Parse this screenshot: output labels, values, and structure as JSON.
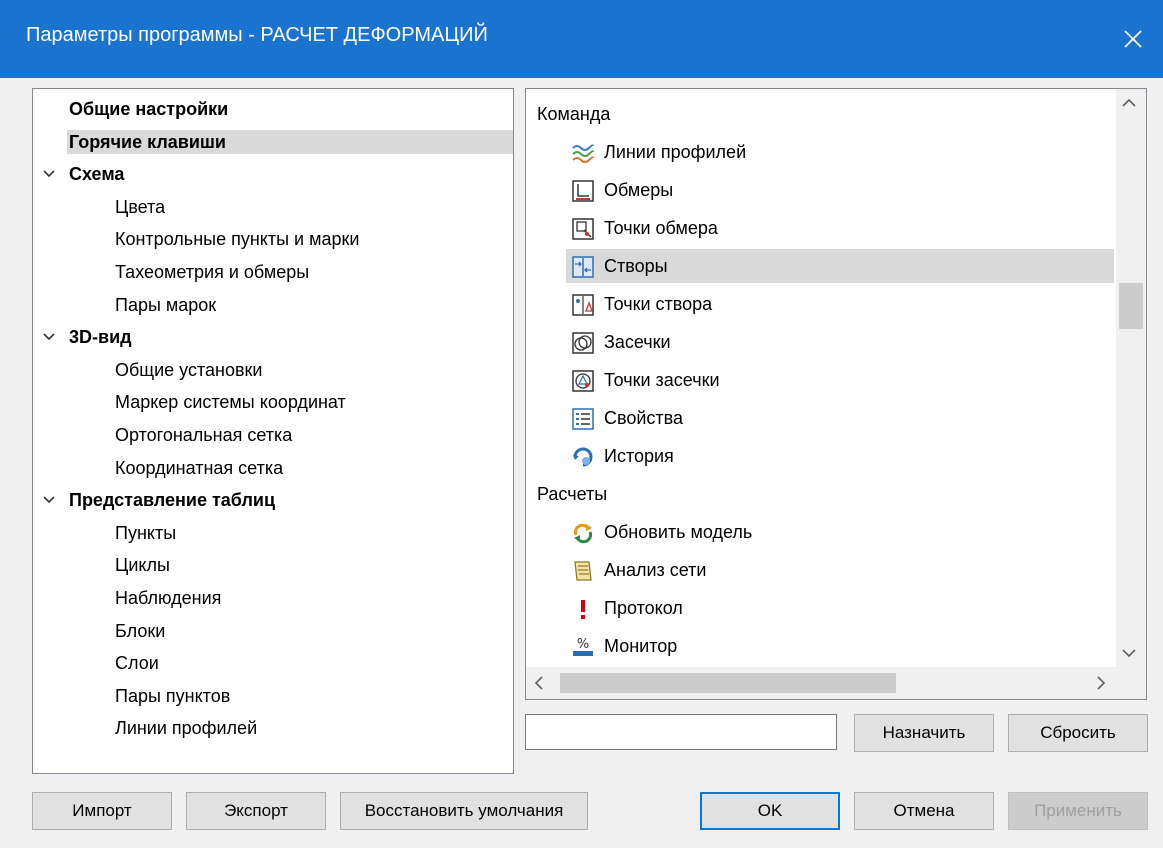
{
  "window": {
    "title": "Параметры программы - РАСЧЕТ ДЕФОРМАЦИЙ",
    "close_glyph": "✕"
  },
  "tree": {
    "items": [
      {
        "label": "Общие настройки",
        "level": 0,
        "bold": true,
        "expandable": false,
        "selected": false
      },
      {
        "label": "Горячие клавиши",
        "level": 0,
        "bold": true,
        "expandable": false,
        "selected": true
      },
      {
        "label": "Схема",
        "level": 0,
        "bold": true,
        "expandable": true,
        "selected": false
      },
      {
        "label": "Цвета",
        "level": 1,
        "bold": false,
        "expandable": false,
        "selected": false
      },
      {
        "label": "Контрольные пункты и марки",
        "level": 1,
        "bold": false,
        "expandable": false,
        "selected": false
      },
      {
        "label": "Тахеометрия и обмеры",
        "level": 1,
        "bold": false,
        "expandable": false,
        "selected": false
      },
      {
        "label": "Пары марок",
        "level": 1,
        "bold": false,
        "expandable": false,
        "selected": false
      },
      {
        "label": "3D-вид",
        "level": 0,
        "bold": true,
        "expandable": true,
        "selected": false
      },
      {
        "label": "Общие установки",
        "level": 1,
        "bold": false,
        "expandable": false,
        "selected": false
      },
      {
        "label": "Маркер системы координат",
        "level": 1,
        "bold": false,
        "expandable": false,
        "selected": false
      },
      {
        "label": "Ортогональная сетка",
        "level": 1,
        "bold": false,
        "expandable": false,
        "selected": false
      },
      {
        "label": "Координатная сетка",
        "level": 1,
        "bold": false,
        "expandable": false,
        "selected": false
      },
      {
        "label": "Представление таблиц",
        "level": 0,
        "bold": true,
        "expandable": true,
        "selected": false
      },
      {
        "label": "Пункты",
        "level": 1,
        "bold": false,
        "expandable": false,
        "selected": false
      },
      {
        "label": "Циклы",
        "level": 1,
        "bold": false,
        "expandable": false,
        "selected": false
      },
      {
        "label": "Наблюдения",
        "level": 1,
        "bold": false,
        "expandable": false,
        "selected": false
      },
      {
        "label": "Блоки",
        "level": 1,
        "bold": false,
        "expandable": false,
        "selected": false
      },
      {
        "label": "Слои",
        "level": 1,
        "bold": false,
        "expandable": false,
        "selected": false
      },
      {
        "label": "Пары пунктов",
        "level": 1,
        "bold": false,
        "expandable": false,
        "selected": false
      },
      {
        "label": "Линии профилей",
        "level": 1,
        "bold": false,
        "expandable": false,
        "selected": false
      }
    ]
  },
  "commands": {
    "groups": [
      {
        "label": "Команда",
        "items": [
          {
            "label": "Линии профилей",
            "icon": "profile-lines-icon",
            "selected": false
          },
          {
            "label": "Обмеры",
            "icon": "measurements-icon",
            "selected": false
          },
          {
            "label": "Точки обмера",
            "icon": "measurement-points-icon",
            "selected": false
          },
          {
            "label": "Створы",
            "icon": "alignments-icon",
            "selected": true
          },
          {
            "label": "Точки створа",
            "icon": "alignment-points-icon",
            "selected": false
          },
          {
            "label": "Засечки",
            "icon": "intersections-icon",
            "selected": false
          },
          {
            "label": "Точки засечки",
            "icon": "intersection-points-icon",
            "selected": false
          },
          {
            "label": "Свойства",
            "icon": "properties-icon",
            "selected": false
          },
          {
            "label": "История",
            "icon": "history-icon",
            "selected": false
          }
        ]
      },
      {
        "label": "Расчеты",
        "items": [
          {
            "label": "Обновить модель",
            "icon": "refresh-model-icon",
            "selected": false
          },
          {
            "label": "Анализ сети",
            "icon": "network-analysis-icon",
            "selected": false
          },
          {
            "label": "Протокол",
            "icon": "protocol-icon",
            "selected": false
          },
          {
            "label": "Монитор",
            "icon": "monitor-icon",
            "selected": false
          }
        ]
      }
    ]
  },
  "hotkey": {
    "value": "",
    "assign_label": "Назначить",
    "reset_label": "Сбросить"
  },
  "footer": {
    "import_label": "Импорт",
    "export_label": "Экспорт",
    "restore_label": "Восстановить умолчания",
    "ok_label": "OK",
    "cancel_label": "Отмена",
    "apply_label": "Применить"
  },
  "colors": {
    "titlebar": "#1b73d0",
    "selection": "#d9d9d9",
    "primary_border": "#0078d7"
  }
}
